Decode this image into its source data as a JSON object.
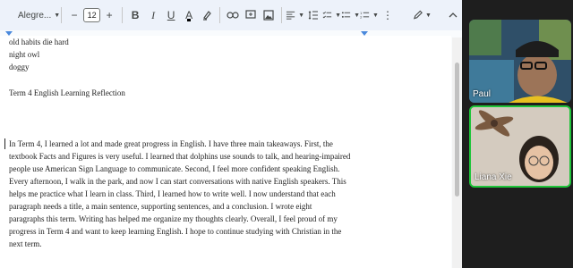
{
  "toolbar": {
    "font_name": "Alegre...",
    "font_size": "12",
    "minus_label": "−",
    "plus_label": "+",
    "bold_label": "B",
    "italic_label": "I",
    "underline_label": "U",
    "text_color_label": "A",
    "icons": [
      "font-dropdown",
      "decrease-size",
      "increase-size",
      "bold",
      "italic",
      "underline",
      "text-color",
      "highlight",
      "link",
      "comment",
      "image",
      "align",
      "line-spacing",
      "checklist",
      "bulleted-list",
      "numbered-list",
      "editing-mode-pencil",
      "collapse-chevron"
    ]
  },
  "document": {
    "lines": [
      "old habits die hard",
      "night owl",
      "doggy",
      "Term 4 English Learning Reflection",
      "In Term 4, I learned a lot and made great progress in English. I have three main takeaways. First, the",
      "textbook Facts and Figures is very useful. I learned that dolphins use sounds to talk, and hearing-impaired",
      "people use American Sign Language to communicate. Second, I feel more confident speaking English.",
      "Every afternoon, I walk in the park, and now I can start conversations with native English speakers. This",
      "helps me practice what I learn in class. Third, I learned how to write well. I now understand that each",
      "paragraph needs a title, a main sentence, supporting sentences, and a conclusion. I wrote eight",
      "paragraphs this term. Writing has helped me organize my thoughts clearly. Overall, I feel proud of my",
      "progress in Term 4 and want to keep learning English. I hope to continue studying with Christian in the",
      "next term."
    ]
  },
  "video": {
    "participants": [
      {
        "name": "Paul"
      },
      {
        "name": "Liana Xie",
        "active_speaker": true
      }
    ],
    "active_border_color": "#1fc53a"
  }
}
